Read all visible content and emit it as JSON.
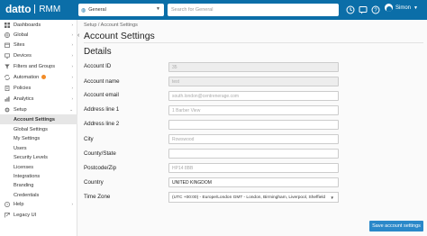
{
  "app": {
    "logo_text": "datto",
    "product": "RMM"
  },
  "header": {
    "site_select": "General",
    "search_placeholder": "Search for General",
    "user_name": "Simon"
  },
  "sidebar": {
    "items": [
      {
        "label": "Dashboards",
        "icon": "dashboard-icon",
        "expand": "›"
      },
      {
        "label": "Global",
        "icon": "globe-icon",
        "expand": "›"
      },
      {
        "label": "Sites",
        "icon": "sites-icon",
        "expand": "›"
      },
      {
        "label": "Devices",
        "icon": "devices-icon",
        "expand": "›"
      },
      {
        "label": "Filters and Groups",
        "icon": "filter-icon",
        "expand": "›"
      },
      {
        "label": "Automation",
        "icon": "automation-icon",
        "expand": "›"
      },
      {
        "label": "Policies",
        "icon": "policies-icon",
        "expand": "›"
      },
      {
        "label": "Analytics",
        "icon": "analytics-icon",
        "expand": "›"
      },
      {
        "label": "Setup",
        "icon": "gear-icon",
        "expand": "⌄"
      },
      {
        "label": "Help",
        "icon": "help-icon",
        "expand": "›"
      },
      {
        "label": "Legacy UI",
        "icon": "legacy-icon",
        "expand": ""
      }
    ],
    "setup_subitems": [
      "Account Settings",
      "Global Settings",
      "My Settings",
      "Users",
      "Security Levels",
      "Licenses",
      "Integrations",
      "Branding",
      "Credentials"
    ]
  },
  "main": {
    "breadcrumb": "Setup / Account Settings",
    "title": "Account Settings",
    "section": "Details",
    "fields": [
      {
        "label": "Account ID",
        "value": "35",
        "disabled": true
      },
      {
        "label": "Account name",
        "value": "test",
        "disabled": true
      },
      {
        "label": "Account email",
        "value": "south.london@centrenerage.com",
        "disabled": false
      },
      {
        "label": "Address line 1",
        "value": "1 Barber View",
        "disabled": false
      },
      {
        "label": "Address line 2",
        "value": "",
        "disabled": false
      },
      {
        "label": "City",
        "value": "Rowswood",
        "disabled": false
      },
      {
        "label": "County/State",
        "value": "",
        "disabled": false
      },
      {
        "label": "Postcode/Zip",
        "value": "HP14 8BB",
        "disabled": false
      },
      {
        "label": "Country",
        "value": "UNITED KINGDOM",
        "disabled": false
      }
    ],
    "timezone_label": "Time Zone",
    "timezone_value": "(UTC +00:00) - Europe/London GMT - London, Birmingham, Liverpool, Sheffield",
    "save_label": "Save account settings"
  },
  "colors": {
    "topbar": "#0b6ea8",
    "accent": "#2a88c9",
    "badge": "#f28c28"
  }
}
